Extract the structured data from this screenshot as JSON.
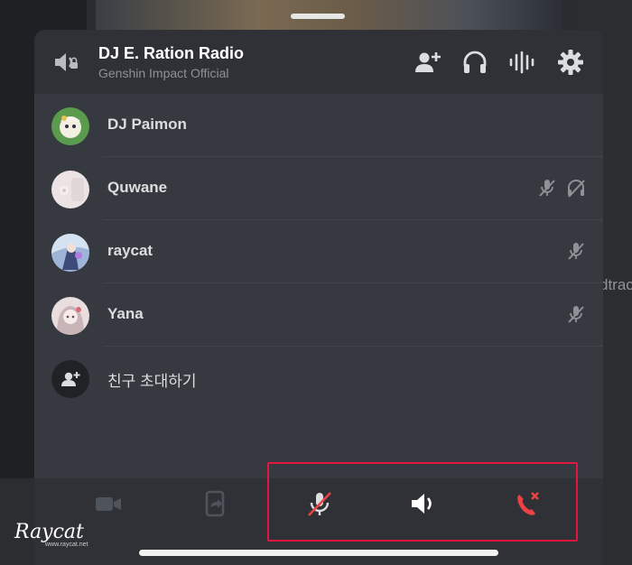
{
  "background": {
    "peek_text": "dtrac"
  },
  "header": {
    "title": "DJ E. Ration Radio",
    "subtitle": "Genshin Impact Official",
    "icons": [
      "speaker-icon",
      "add-user-icon",
      "headphones-icon",
      "waveform-icon",
      "gear-icon"
    ]
  },
  "members": [
    {
      "name": "DJ Paimon",
      "self_muted": false,
      "deafened": false,
      "avatar_color": "#5a9b4e"
    },
    {
      "name": "Quwane",
      "self_muted": true,
      "deafened": true,
      "avatar_color": "#e9dfe0"
    },
    {
      "name": "raycat",
      "self_muted": true,
      "deafened": false,
      "avatar_color": "#6f86b8"
    },
    {
      "name": "Yana",
      "self_muted": true,
      "deafened": false,
      "avatar_color": "#e8d6d6"
    }
  ],
  "invite": {
    "label": "친구 초대하기"
  },
  "controls": {
    "items": [
      "video-icon",
      "screen-share-icon",
      "mic-muted-icon",
      "speaker-on-icon",
      "leave-call-icon"
    ]
  },
  "colors": {
    "sheet_bg": "#36393f",
    "header_bg": "#2f3136",
    "danger": "#ed4245",
    "highlight_box": "#e0163e"
  },
  "watermark": {
    "text": "Raycat",
    "url": "www.raycat.net"
  }
}
